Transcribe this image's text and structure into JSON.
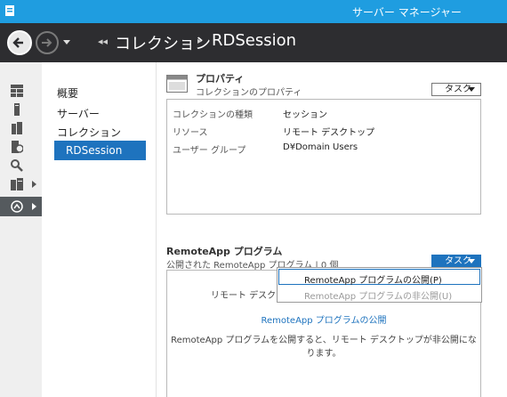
{
  "window": {
    "title": "サーバー マネージャー"
  },
  "breadcrumb": {
    "part1": "コレクション",
    "part2": "RDSession"
  },
  "rail": {
    "icons": [
      "dashboard-icon",
      "local-server-icon",
      "all-servers-icon",
      "file-storage-icon",
      "iis-icon",
      "file-services-icon",
      "remote-desktop-icon"
    ]
  },
  "subnav": {
    "items": [
      "概要",
      "サーバー",
      "コレクション",
      "RDSession"
    ]
  },
  "properties": {
    "title": "プロパティ",
    "subtitle": "コレクションのプロパティ",
    "task_label": "タスク",
    "rows": [
      {
        "key": "コレクションの種類",
        "value": "セッション"
      },
      {
        "key": "リソース",
        "value": "リモート デスクトップ"
      },
      {
        "key": "ユーザー グループ",
        "value": "D¥Domain Users"
      }
    ]
  },
  "remoteapp": {
    "title": "RemoteApp プログラム",
    "subtitle": "公開された RemoteApp プログラム | 0 個",
    "task_label": "タスク",
    "rd_label": "リモート デスクトップ",
    "publish_link": "RemoteApp プログラムの公開",
    "note": "RemoteApp プログラムを公開すると、リモート デスクトップが非公開になります。"
  },
  "task_menu": {
    "items": [
      "RemoteApp プログラムの公開(P)",
      "RemoteApp プログラムの非公開(U)"
    ]
  },
  "colors": {
    "titlebar": "#1f9de0",
    "navbar": "#2d2d30",
    "accent": "#1e73be"
  }
}
